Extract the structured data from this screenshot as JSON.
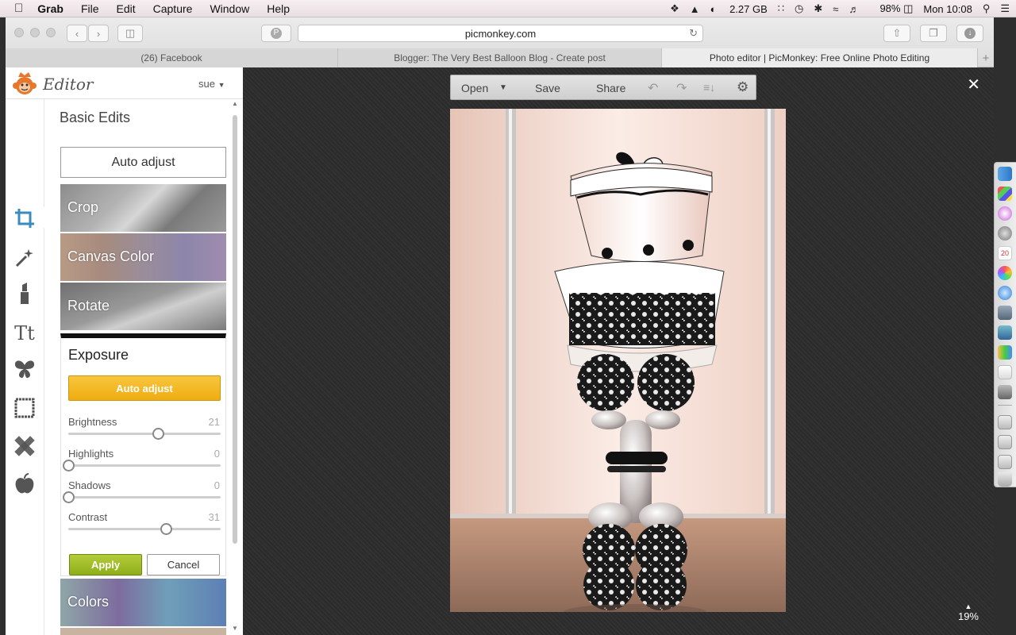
{
  "menubar": {
    "app": "Grab",
    "items": [
      "File",
      "Edit",
      "Capture",
      "Window",
      "Help"
    ],
    "memory": "2.27 GB",
    "battery": "98%",
    "clock": "Mon 10:08"
  },
  "browser": {
    "url": "picmonkey.com",
    "tabs": [
      {
        "label": "(26) Facebook"
      },
      {
        "label": "Blogger: The Very Best Balloon Blog - Create post"
      },
      {
        "label": "Photo editor | PicMonkey: Free Online Photo Editing"
      }
    ],
    "new_tab": "+"
  },
  "editor": {
    "brand": "Editor",
    "user": "sue",
    "panel_title": "Basic Edits",
    "auto_adjust": "Auto adjust",
    "tiles": [
      {
        "label": "Crop"
      },
      {
        "label": "Canvas Color"
      },
      {
        "label": "Rotate"
      },
      {
        "label": "Colors"
      }
    ],
    "exposure": {
      "title": "Exposure",
      "auto_adjust": "Auto adjust",
      "sliders": [
        {
          "label": "Brightness",
          "value": "21",
          "level": 0.59
        },
        {
          "label": "Highlights",
          "value": "0",
          "level": 0.0
        },
        {
          "label": "Shadows",
          "value": "0",
          "level": 0.0
        },
        {
          "label": "Contrast",
          "value": "31",
          "level": 0.64
        }
      ],
      "apply": "Apply",
      "cancel": "Cancel"
    }
  },
  "toolbar": {
    "open": "Open",
    "save": "Save",
    "share": "Share"
  },
  "canvas": {
    "zoom": "19%"
  },
  "colors": {
    "accent_yellow": "#f2b21a",
    "apply_green": "#9cb82a",
    "tool_active": "#3b8bbf"
  }
}
